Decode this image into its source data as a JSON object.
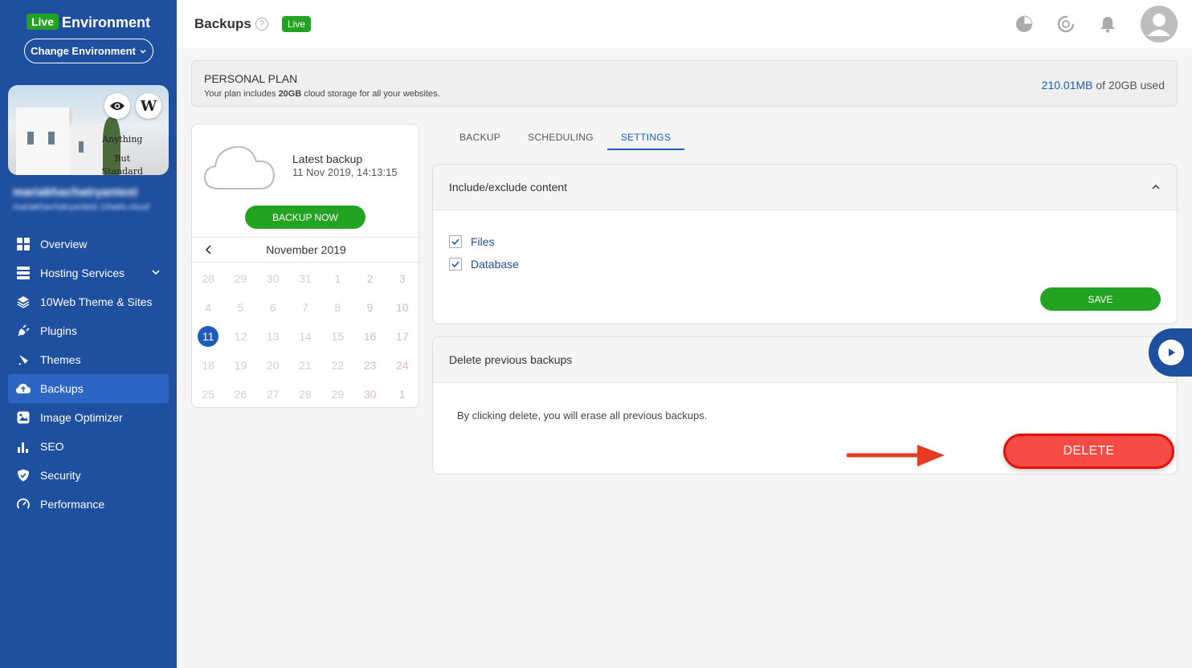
{
  "sidebar": {
    "env_badge": "Live",
    "env_title": "Environment",
    "change_env": "Change Environment",
    "site_caption": [
      "Anything",
      "But",
      "Standard"
    ],
    "site_name": "mariakhachatryantest",
    "site_url": "mariakhachatryantest.10web.cloud",
    "items": [
      {
        "label": "Overview",
        "icon": "grid-icon"
      },
      {
        "label": "Hosting Services",
        "icon": "server-icon"
      },
      {
        "label": "10Web Theme & Sites",
        "icon": "layers-icon"
      },
      {
        "label": "Plugins",
        "icon": "plug-icon"
      },
      {
        "label": "Themes",
        "icon": "brush-icon"
      },
      {
        "label": "Backups",
        "icon": "cloud-backup-icon",
        "active": true
      },
      {
        "label": "Image Optimizer",
        "icon": "image-icon"
      },
      {
        "label": "SEO",
        "icon": "bar-chart-icon"
      },
      {
        "label": "Security",
        "icon": "shield-icon"
      },
      {
        "label": "Performance",
        "icon": "gauge-icon"
      }
    ]
  },
  "header": {
    "title": "Backups",
    "live_badge": "Live"
  },
  "plan": {
    "title": "PERSONAL PLAN",
    "desc_prefix": "Your plan includes ",
    "desc_bold": "20GB",
    "desc_suffix": " cloud storage for all your websites.",
    "used_amount": "210.01MB",
    "used_suffix": " of 20GB used"
  },
  "backup_card": {
    "latest_label": "Latest backup",
    "latest_value": "11 Nov 2019, 14:13:15",
    "backup_now": "BACKUP NOW",
    "calendar_month": "November 2019",
    "calendar_days": [
      "28",
      "29",
      "30",
      "31",
      "1",
      "2",
      "3",
      "4",
      "5",
      "6",
      "7",
      "8",
      "9",
      "10",
      "11",
      "12",
      "13",
      "14",
      "15",
      "16",
      "17",
      "18",
      "19",
      "20",
      "21",
      "22",
      "23",
      "24",
      "25",
      "26",
      "27",
      "28",
      "29",
      "30",
      "1"
    ],
    "selected_day": "11"
  },
  "tabs": [
    "BACKUP",
    "SCHEDULING",
    "SETTINGS"
  ],
  "active_tab": "SETTINGS",
  "include_panel": {
    "title": "Include/exclude content",
    "options": [
      "Files",
      "Database"
    ],
    "save": "SAVE"
  },
  "delete_panel": {
    "title": "Delete previous backups",
    "text": "By clicking delete, you will erase all previous backups.",
    "delete": "DELETE"
  },
  "colors": {
    "sidebar": "#1f4f9f",
    "green": "#22a322",
    "blue": "#1f5bb8",
    "delete": "#f44b45",
    "arrow": "#e53b25"
  }
}
